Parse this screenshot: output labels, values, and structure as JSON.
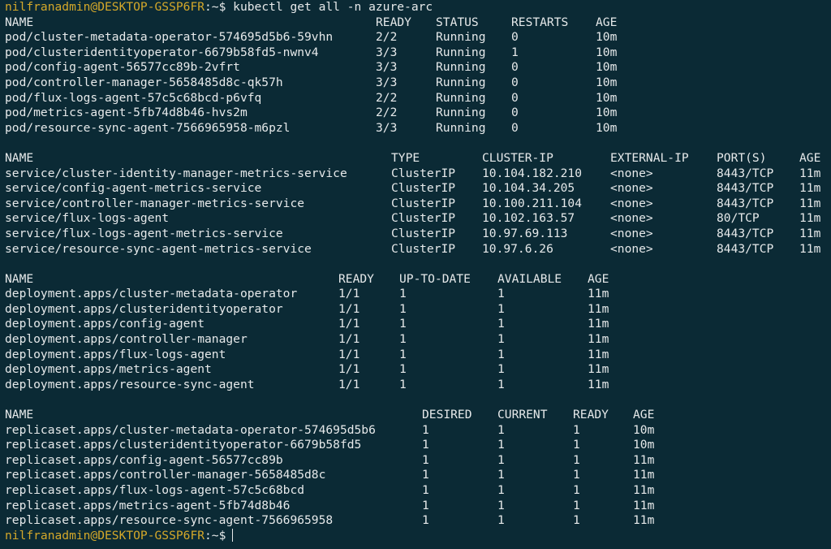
{
  "colors": {
    "background": "#0b2a35",
    "text": "#e6e9ea",
    "prompt_user_host": "#d4a82a"
  },
  "prompt": {
    "user_host": "nilfranadmin@DESKTOP-GSSP6FR",
    "path_symbol": ":~$",
    "command": "kubectl get all -n azure-arc"
  },
  "pods": {
    "headers": [
      "NAME",
      "READY",
      "STATUS",
      "RESTARTS",
      "AGE"
    ],
    "rows": [
      [
        "pod/cluster-metadata-operator-574695d5b6-59vhn",
        "2/2",
        "Running",
        "0",
        "10m"
      ],
      [
        "pod/clusteridentityoperator-6679b58fd5-nwnv4",
        "3/3",
        "Running",
        "1",
        "10m"
      ],
      [
        "pod/config-agent-56577cc89b-2vfrt",
        "3/3",
        "Running",
        "0",
        "10m"
      ],
      [
        "pod/controller-manager-5658485d8c-qk57h",
        "3/3",
        "Running",
        "0",
        "10m"
      ],
      [
        "pod/flux-logs-agent-57c5c68bcd-p6vfq",
        "2/2",
        "Running",
        "0",
        "10m"
      ],
      [
        "pod/metrics-agent-5fb74d8b46-hvs2m",
        "2/2",
        "Running",
        "0",
        "10m"
      ],
      [
        "pod/resource-sync-agent-7566965958-m6pzl",
        "3/3",
        "Running",
        "0",
        "10m"
      ]
    ]
  },
  "services": {
    "headers": [
      "NAME",
      "TYPE",
      "CLUSTER-IP",
      "EXTERNAL-IP",
      "PORT(S)",
      "AGE"
    ],
    "rows": [
      [
        "service/cluster-identity-manager-metrics-service",
        "ClusterIP",
        "10.104.182.210",
        "<none>",
        "8443/TCP",
        "11m"
      ],
      [
        "service/config-agent-metrics-service",
        "ClusterIP",
        "10.104.34.205",
        "<none>",
        "8443/TCP",
        "11m"
      ],
      [
        "service/controller-manager-metrics-service",
        "ClusterIP",
        "10.100.211.104",
        "<none>",
        "8443/TCP",
        "11m"
      ],
      [
        "service/flux-logs-agent",
        "ClusterIP",
        "10.102.163.57",
        "<none>",
        "80/TCP",
        "11m"
      ],
      [
        "service/flux-logs-agent-metrics-service",
        "ClusterIP",
        "10.97.69.113",
        "<none>",
        "8443/TCP",
        "11m"
      ],
      [
        "service/resource-sync-agent-metrics-service",
        "ClusterIP",
        "10.97.6.26",
        "<none>",
        "8443/TCP",
        "11m"
      ]
    ]
  },
  "deployments": {
    "headers": [
      "NAME",
      "READY",
      "UP-TO-DATE",
      "AVAILABLE",
      "AGE"
    ],
    "rows": [
      [
        "deployment.apps/cluster-metadata-operator",
        "1/1",
        "1",
        "1",
        "11m"
      ],
      [
        "deployment.apps/clusteridentityoperator",
        "1/1",
        "1",
        "1",
        "11m"
      ],
      [
        "deployment.apps/config-agent",
        "1/1",
        "1",
        "1",
        "11m"
      ],
      [
        "deployment.apps/controller-manager",
        "1/1",
        "1",
        "1",
        "11m"
      ],
      [
        "deployment.apps/flux-logs-agent",
        "1/1",
        "1",
        "1",
        "11m"
      ],
      [
        "deployment.apps/metrics-agent",
        "1/1",
        "1",
        "1",
        "11m"
      ],
      [
        "deployment.apps/resource-sync-agent",
        "1/1",
        "1",
        "1",
        "11m"
      ]
    ]
  },
  "replicasets": {
    "headers": [
      "NAME",
      "DESIRED",
      "CURRENT",
      "READY",
      "AGE"
    ],
    "rows": [
      [
        "replicaset.apps/cluster-metadata-operator-574695d5b6",
        "1",
        "1",
        "1",
        "10m"
      ],
      [
        "replicaset.apps/clusteridentityoperator-6679b58fd5",
        "1",
        "1",
        "1",
        "10m"
      ],
      [
        "replicaset.apps/config-agent-56577cc89b",
        "1",
        "1",
        "1",
        "11m"
      ],
      [
        "replicaset.apps/controller-manager-5658485d8c",
        "1",
        "1",
        "1",
        "11m"
      ],
      [
        "replicaset.apps/flux-logs-agent-57c5c68bcd",
        "1",
        "1",
        "1",
        "11m"
      ],
      [
        "replicaset.apps/metrics-agent-5fb74d8b46",
        "1",
        "1",
        "1",
        "11m"
      ],
      [
        "replicaset.apps/resource-sync-agent-7566965958",
        "1",
        "1",
        "1",
        "11m"
      ]
    ]
  }
}
